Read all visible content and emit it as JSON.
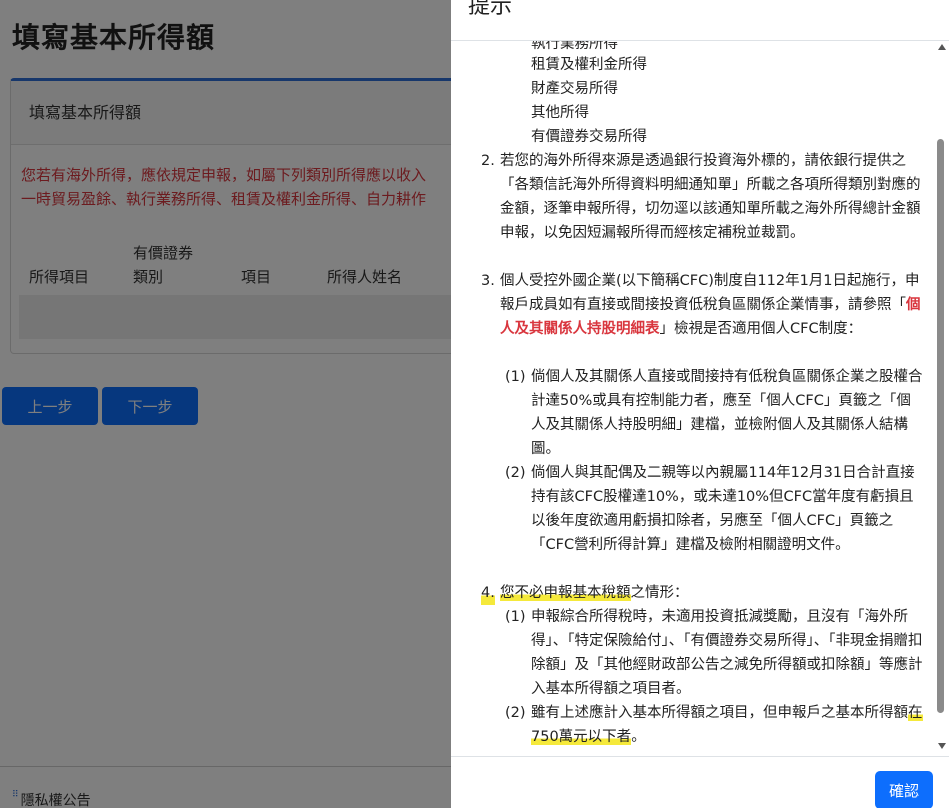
{
  "page": {
    "title": "填寫基本所得額",
    "card_header": "填寫基本所得額",
    "warning_line1": "您若有海外所得，應依規定申報，如屬下列類別所得應以收入",
    "warning_line2": "一時貿易盈餘、執行業務所得、租賃及權利金所得、自力耕作",
    "table_headers": {
      "income_item": "所得項目",
      "securities_line1": "有價證券",
      "securities_line2": "類別",
      "item": "項目",
      "earner_name": "所得人姓名"
    },
    "prev_button": "上一步",
    "next_button": "下一步",
    "footer_text": "隱私權公告"
  },
  "modal": {
    "title": "提示",
    "partial_top": "執行業務所得",
    "sub_list": [
      "租賃及權利金所得",
      "財產交易所得",
      "其他所得",
      "有價證券交易所得"
    ],
    "item2": {
      "num": "2.",
      "text": "若您的海外所得來源是透過銀行投資海外標的，請依銀行提供之「各類信託海外所得資料明細通知單」所載之各項所得類別對應的金額，逐筆申報所得，切勿逕以該通知單所載之海外所得總計金額申報，以免因短漏報所得而經核定補稅並裁罰。"
    },
    "item3": {
      "num": "3.",
      "text_before": "個人受控外國企業(以下簡稱CFC)制度自112年1月1日起施行，申報戶成員如有直接或間接投資低稅負區關係企業情事，請參照「",
      "link": "個人及其關係人持股明細表",
      "text_after": "」檢視是否適用個人CFC制度：",
      "sub1_num": "(1)",
      "sub1": "倘個人及其關係人直接或間接持有低稅負區關係企業之股權合計達50%或具有控制能力者，應至「個人CFC」頁籤之「個人及其關係人持股明細」建檔，並檢附個人及其關係人結構圖。",
      "sub2_num": "(2)",
      "sub2": "倘個人與其配偶及二親等以內親屬114年12月31日合計直接持有該CFC股權達10%，或未達10%但CFC當年度有虧損且以後年度欲適用虧損扣除者，另應至「個人CFC」頁籤之「CFC營利所得計算」建檔及檢附相關證明文件。"
    },
    "item4": {
      "num": "4.",
      "text_hl": "您不必申報基本稅額",
      "text_after": "之情形：",
      "sub1_num": "(1)",
      "sub1": "申報綜合所得稅時，未適用投資抵減獎勵，且沒有「海外所得」、「特定保險給付」、「有價證券交易所得」、「非現金捐贈扣除額」及「其他經財政部公告之減免所得額或扣除額」等應計入基本所得額之項目者。",
      "sub2_num": "(2)",
      "sub2_before": "雖有上述應計入基本所得額之項目，但申報戶之基本所得額",
      "sub2_hl": "在750萬元以下者",
      "sub2_after": "。"
    },
    "confirm_button": "確認"
  }
}
